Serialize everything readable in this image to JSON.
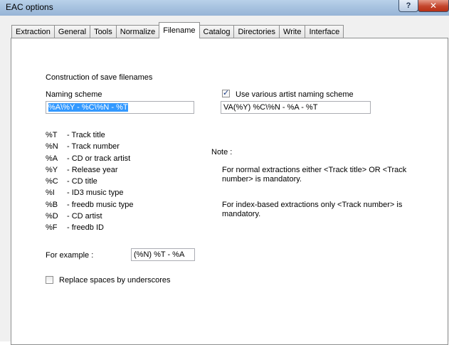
{
  "window": {
    "title": "EAC options",
    "help_label": "?",
    "close_label": "✕"
  },
  "tabs": [
    {
      "label": "Extraction"
    },
    {
      "label": "General"
    },
    {
      "label": "Tools"
    },
    {
      "label": "Normalize"
    },
    {
      "label": "Filename"
    },
    {
      "label": "Catalog"
    },
    {
      "label": "Directories"
    },
    {
      "label": "Write"
    },
    {
      "label": "Interface"
    }
  ],
  "filename": {
    "section_title": "Construction of save filenames",
    "naming_label": "Naming scheme",
    "naming_value": "%A\\%Y - %C\\%N - %T",
    "various_label": "Use various artist naming scheme",
    "various_value": "VA(%Y) %C\\%N - %A - %T",
    "legend": [
      {
        "code": "%T",
        "desc": "- Track title"
      },
      {
        "code": "%N",
        "desc": "- Track number"
      },
      {
        "code": "%A",
        "desc": "- CD or track artist"
      },
      {
        "code": "%Y",
        "desc": "- Release year"
      },
      {
        "code": "%C",
        "desc": "- CD title"
      },
      {
        "code": "%I",
        "desc": "- ID3 music type"
      },
      {
        "code": "%B",
        "desc": "- freedb music type"
      },
      {
        "code": "%D",
        "desc": "- CD artist"
      },
      {
        "code": "%F",
        "desc": "- freedb ID"
      }
    ],
    "note_title": "Note :",
    "note1_line1": "For normal extractions either <Track title>  OR  <Track",
    "note1_line2": "number> is mandatory.",
    "note2_line1": "For index-based extractions only <Track number> is",
    "note2_line2": "mandatory.",
    "example_label": "For example :",
    "example_value": "(%N) %T - %A",
    "replace_label": "Replace spaces by underscores"
  }
}
